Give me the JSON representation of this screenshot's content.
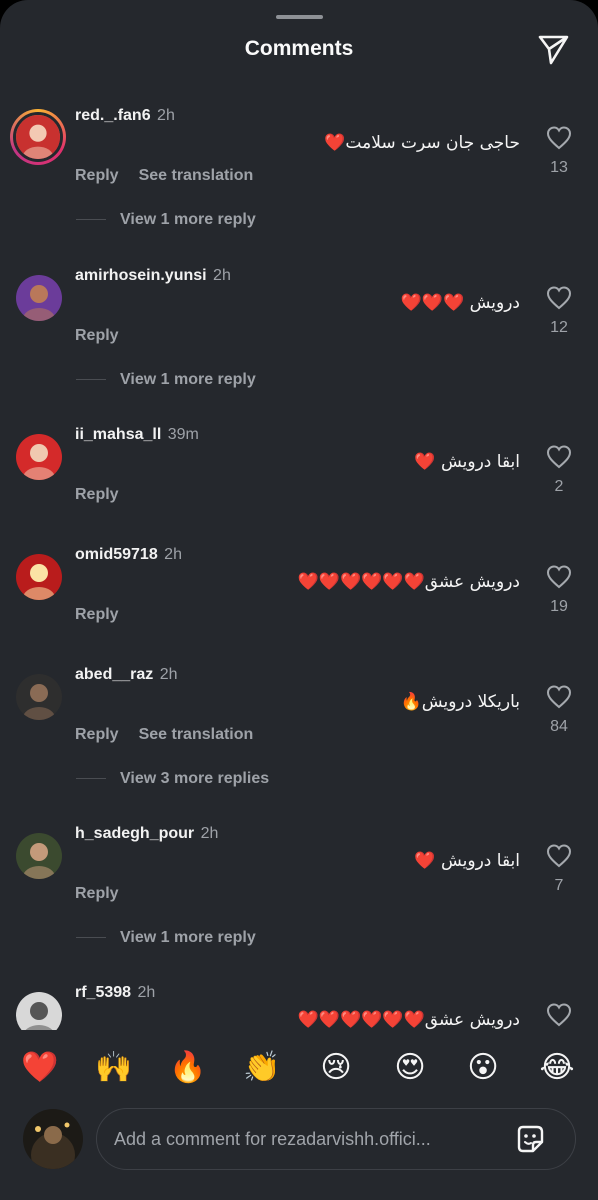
{
  "header": {
    "title": "Comments"
  },
  "comments": [
    {
      "user": "red._.fan6",
      "time": "2h",
      "text": "حاجی جان سرت سلامت❤️",
      "likes": "13",
      "reply": "Reply",
      "translate": "See translation",
      "more": "View 1 more reply",
      "avatar_colors": [
        "#c8312f",
        "#f3c9b3"
      ],
      "story_ring": true
    },
    {
      "user": "amirhosein.yunsi",
      "time": "2h",
      "text": "درویش ❤️❤️❤️",
      "likes": "12",
      "reply": "Reply",
      "more": "View 1 more reply",
      "avatar_colors": [
        "#6b3c9a",
        "#b9785a"
      ]
    },
    {
      "user": "ii_mahsa_ll",
      "time": "39m",
      "text": "ابقا درویش ❤️",
      "likes": "2",
      "reply": "Reply",
      "avatar_colors": [
        "#d42a2a",
        "#f0c9b0"
      ]
    },
    {
      "user": "omid59718",
      "time": "2h",
      "text": "درویش عشق❤️❤️❤️❤️❤️❤️",
      "likes": "19",
      "reply": "Reply",
      "avatar_colors": [
        "#b91c1c",
        "#fbe3a5"
      ]
    },
    {
      "user": "abed__raz",
      "time": "2h",
      "text": "باریکلا درویش🔥",
      "likes": "84",
      "reply": "Reply",
      "translate": "See translation",
      "more": "View 3 more replies",
      "avatar_colors": [
        "#2e2e2e",
        "#8a6b55"
      ]
    },
    {
      "user": "h_sadegh_pour",
      "time": "2h",
      "text": "ابقا درویش ❤️",
      "likes": "7",
      "reply": "Reply",
      "more": "View 1 more reply",
      "avatar_colors": [
        "#3b4a2f",
        "#c49a7a"
      ]
    },
    {
      "user": "rf_5398",
      "time": "2h",
      "text": "درویش عشق❤️❤️❤️❤️❤️❤️",
      "likes": "",
      "reply": "",
      "avatar_colors": [
        "#d8d8d8",
        "#555555"
      ]
    }
  ],
  "reactions": [
    "❤️",
    "🙌",
    "🔥",
    "👏",
    "😢",
    "😍",
    "😮",
    "😂"
  ],
  "composer": {
    "placeholder": "Add a comment for rezadarvishh.offici..."
  },
  "colors": {
    "background": "#25282d",
    "text": "#f5f5f5",
    "secondary": "#9ea2a8"
  }
}
